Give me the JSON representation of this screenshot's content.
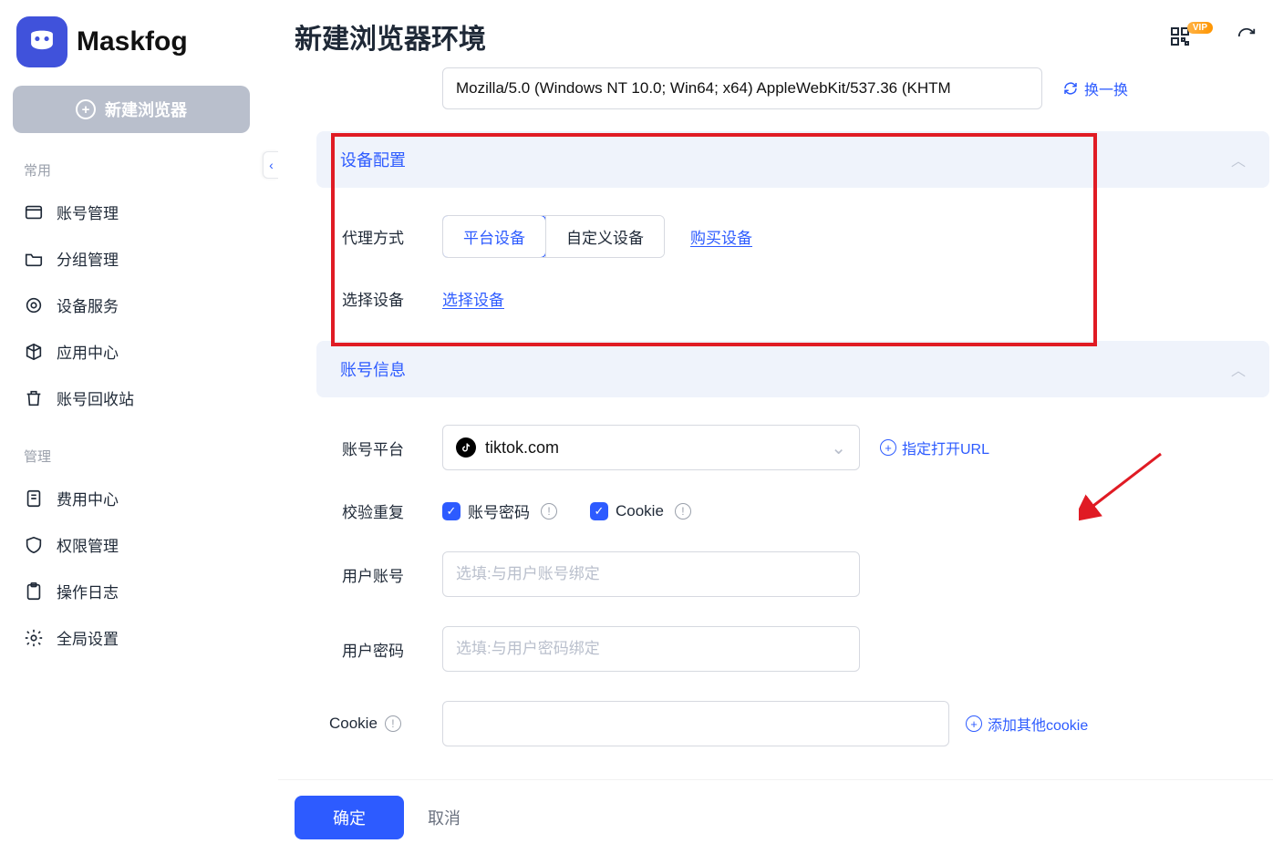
{
  "brand": "Maskfog",
  "sidebar": {
    "new_browser": "新建浏览器",
    "group_common": "常用",
    "group_manage": "管理",
    "items_common": [
      "账号管理",
      "分组管理",
      "设备服务",
      "应用中心",
      "账号回收站"
    ],
    "items_manage": [
      "费用中心",
      "权限管理",
      "操作日志",
      "全局设置"
    ]
  },
  "header": {
    "title": "新建浏览器环境",
    "vip": "VIP"
  },
  "ua": {
    "value": "Mozilla/5.0 (Windows NT 10.0; Win64; x64) AppleWebKit/537.36 (KHTM",
    "refresh": "换一换"
  },
  "sections": {
    "device": {
      "title": "设备配置",
      "proxy_label": "代理方式",
      "seg_platform": "平台设备",
      "seg_custom": "自定义设备",
      "buy_link": "购买设备",
      "select_label": "选择设备",
      "select_link": "选择设备"
    },
    "account": {
      "title": "账号信息",
      "platform_label": "账号平台",
      "platform_value": "tiktok.com",
      "url_link": "指定打开URL",
      "dup_label": "校验重复",
      "chk_pwd": "账号密码",
      "chk_cookie": "Cookie",
      "user_label": "用户账号",
      "user_ph": "选填:与用户账号绑定",
      "pwd_label": "用户密码",
      "pwd_ph": "选填:与用户密码绑定",
      "cookie_label": "Cookie",
      "cookie_link": "添加其他cookie"
    }
  },
  "footer": {
    "ok": "确定",
    "cancel": "取消"
  }
}
